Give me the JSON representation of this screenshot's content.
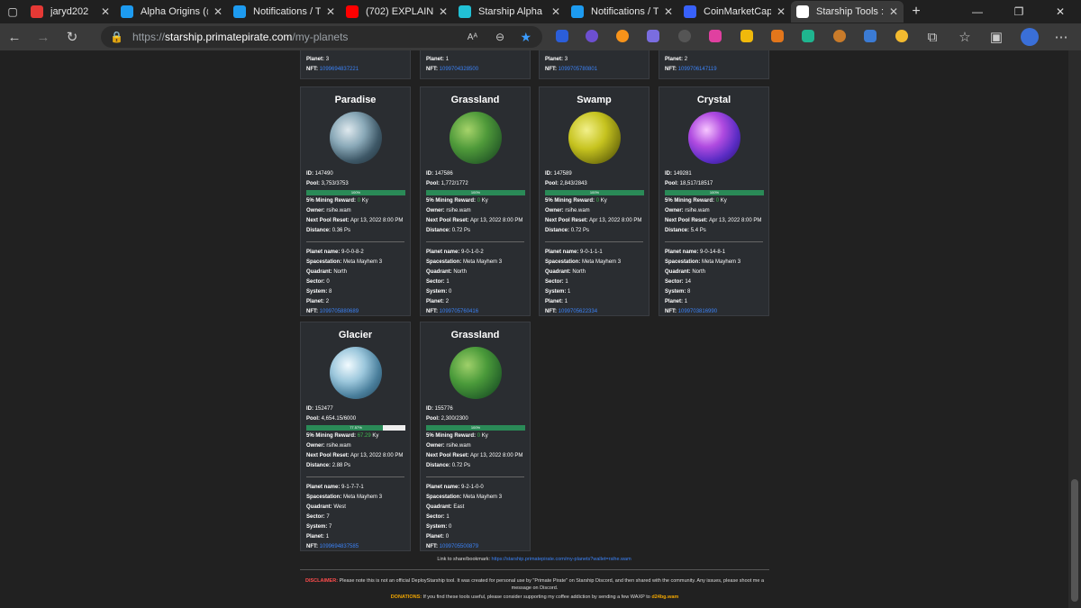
{
  "browser": {
    "tabs": [
      {
        "title": "jaryd202",
        "icon": "youtube-audio-icon",
        "color": "#e53935"
      },
      {
        "title": "Alpha Origins (@/",
        "icon": "twitter-icon",
        "color": "#1d9bf0"
      },
      {
        "title": "Notifications / Tw",
        "icon": "twitter-icon",
        "color": "#1d9bf0"
      },
      {
        "title": "(702) EXPLAINED:",
        "icon": "youtube-icon",
        "color": "#ff0000"
      },
      {
        "title": "Starship Alpha",
        "icon": "starship-icon",
        "color": "#21c1d6"
      },
      {
        "title": "Notifications / Tw",
        "icon": "twitter-icon",
        "color": "#1d9bf0"
      },
      {
        "title": "CoinMarketCap E",
        "icon": "coinmarketcap-icon",
        "color": "#3861fb"
      },
      {
        "title": "Starship Tools :: M",
        "icon": "starship-tools-icon",
        "color": "#ffffff"
      }
    ],
    "url_prefix": "https://",
    "url_host": "starship.primatepirate.com",
    "url_path": "/my-planets"
  },
  "top_partial": [
    {
      "planet": "3",
      "nft": "1099694837221"
    },
    {
      "planet": "1",
      "nft": "1099704328500"
    },
    {
      "planet": "3",
      "nft": "1099705780801"
    },
    {
      "planet": "2",
      "nft": "1099706147119"
    }
  ],
  "labels": {
    "id": "ID:",
    "pool": "Pool:",
    "reward": "5% Mining Reward:",
    "owner": "Owner:",
    "reset": "Next Pool Reset:",
    "distance": "Distance:",
    "pname": "Planet name:",
    "station": "Spacestation:",
    "quadrant": "Quadrant:",
    "sector": "Sector:",
    "system": "System:",
    "planet": "Planet:",
    "nft": "NFT:",
    "ky": "Ky"
  },
  "planets": [
    {
      "name": "Paradise",
      "id": "147490",
      "pool": "3,753/3753",
      "pct_label": "100%",
      "fill": 1.0,
      "reward": "0",
      "owner": "rsihe.wam",
      "reset": "Apr 13, 2022 8:00 PM",
      "distance": "0.36 Ps",
      "pname": "9-0-0-8-2",
      "station": "Meta Mayhem 3",
      "quadrant": "North",
      "sector": "0",
      "system": "8",
      "planet": "2",
      "nft": "1099705880689",
      "grad": "radial-gradient(circle at 35% 35%,#dfe9ee,#8aa9b8 35%,#3e5867 65%,#1b2a33)"
    },
    {
      "name": "Grassland",
      "id": "147586",
      "pool": "1,772/1772",
      "pct_label": "100%",
      "fill": 1.0,
      "reward": "0",
      "owner": "rsihe.wam",
      "reset": "Apr 13, 2022 8:00 PM",
      "distance": "0.72 Ps",
      "pname": "9-0-1-0-2",
      "station": "Meta Mayhem 3",
      "quadrant": "North",
      "sector": "1",
      "system": "0",
      "planet": "2",
      "nft": "1099705760416",
      "grad": "radial-gradient(circle at 35% 35%,#a6d36a,#4f9a3a 40%,#2f6a2c 70%,#173a18)"
    },
    {
      "name": "Swamp",
      "id": "147589",
      "pool": "2,843/2843",
      "pct_label": "100%",
      "fill": 1.0,
      "reward": "0",
      "owner": "rsihe.wam",
      "reset": "Apr 13, 2022 8:00 PM",
      "distance": "0.72 Ps",
      "pname": "9-0-1-1-1",
      "station": "Meta Mayhem 3",
      "quadrant": "North",
      "sector": "1",
      "system": "1",
      "planet": "1",
      "nft": "1099705622334",
      "grad": "radial-gradient(circle at 35% 35%,#f2f08a,#c6c31f 40%,#7d7c0f 72%,#3a3a06)"
    },
    {
      "name": "Crystal",
      "id": "149281",
      "pool": "18,517/18517",
      "pct_label": "100%",
      "fill": 1.0,
      "reward": "0",
      "owner": "rsihe.wam",
      "reset": "Apr 13, 2022 8:00 PM",
      "distance": "5.4 Ps",
      "pname": "9-0-14-8-1",
      "station": "Meta Mayhem 3",
      "quadrant": "North",
      "sector": "14",
      "system": "8",
      "planet": "1",
      "nft": "1099703816990",
      "grad": "radial-gradient(circle at 35% 35%,#f7c6ff,#b04be0 35%,#5a2cc4 65%,#241060)"
    },
    {
      "name": "Glacier",
      "id": "152477",
      "pool": "4,654.15/6000",
      "pct_label": "77.57%",
      "fill": 0.7757,
      "reward": "67.29",
      "owner": "rsihe.wam",
      "reset": "Apr 13, 2022 8:00 PM",
      "distance": "2.88 Ps",
      "pname": "9-1-7-7-1",
      "station": "Meta Mayhem 3",
      "quadrant": "West",
      "sector": "7",
      "system": "7",
      "planet": "1",
      "nft": "1099694837585",
      "grad": "radial-gradient(circle at 35% 35%,#f2fbff,#9cc7dc 35%,#4a7f9c 65%,#1e3e52)"
    },
    {
      "name": "Grassland",
      "id": "155776",
      "pool": "2,300/2300",
      "pct_label": "100%",
      "fill": 1.0,
      "reward": "0",
      "owner": "rsihe.wam",
      "reset": "Apr 13, 2022 8:00 PM",
      "distance": "0.72 Ps",
      "pname": "9-2-1-0-0",
      "station": "Meta Mayhem 3",
      "quadrant": "East",
      "sector": "1",
      "system": "0",
      "planet": "0",
      "nft": "1099705500879",
      "grad": "radial-gradient(circle at 35% 35%,#9fd06a,#4a9a3a 40%,#2a6a2c 70%,#133a18)"
    }
  ],
  "footer": {
    "share_label": "Link to share/bookmark:",
    "share_url": "https://starship.primatepirate.com/my-planets?wallet=rsihe.wam",
    "disclaimer_label": "DISCLAIMER:",
    "disclaimer_text": "Please note this is not an official DeployStarship tool. It was created for personal use by \"Primate Pirate\" on Starship Discord, and then shared with the community. Any issues, please shoot me a message on Discord.",
    "donations_label": "DONATIONS:",
    "donations_text": "If you find these tools useful, please consider supporting my coffee addiction by sending a few WAXP to",
    "donations_wallet": "d24bg.wam"
  }
}
